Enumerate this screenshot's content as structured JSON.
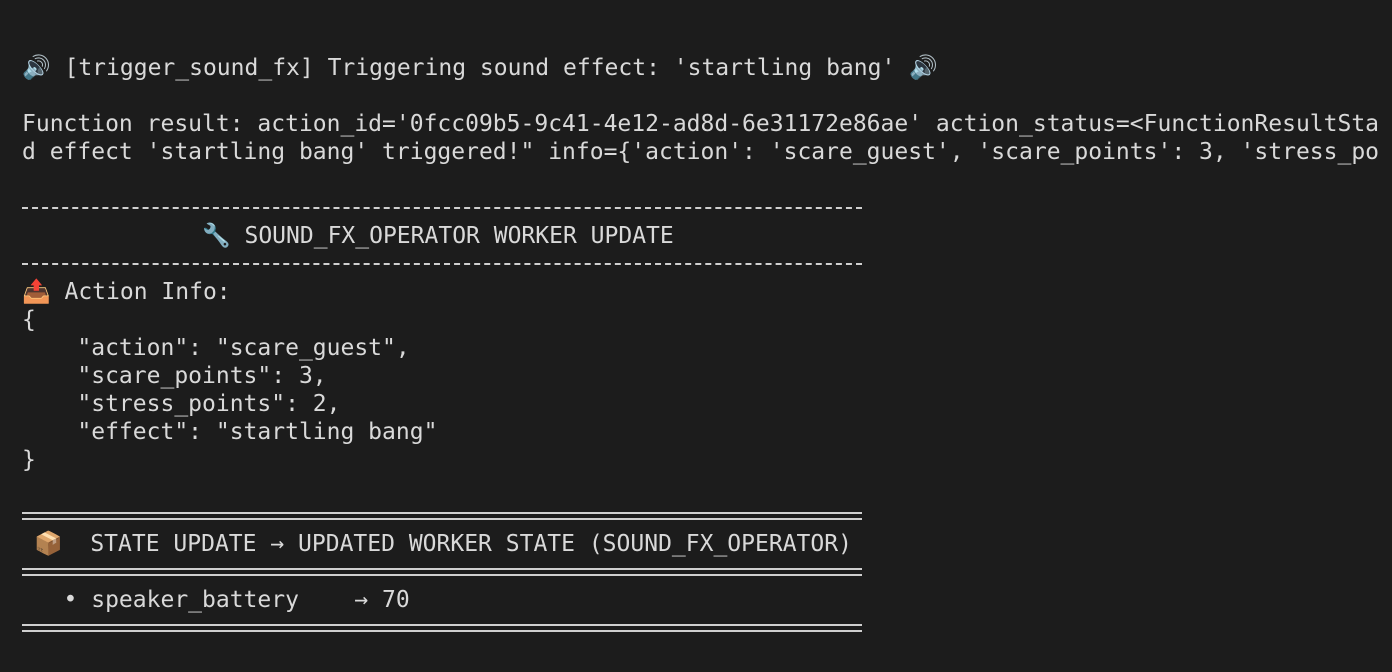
{
  "log": {
    "trigger_line": "🔊 [trigger_sound_fx] Triggering sound effect: 'startling bang' 🔊",
    "result_line_1": "Function result: action_id='0fcc09b5-9c41-4e12-ad8d-6e31172e86ae' action_status=<FunctionResultSta",
    "result_line_2": "d effect 'startling bang' triggered!\" info={'action': 'scare_guest', 'scare_points': 3, 'stress_po"
  },
  "worker_update": {
    "icon": "wrench-icon",
    "title": "🔧 SOUND_FX_OPERATOR WORKER UPDATE",
    "action_info_icon": "outbox-tray-icon",
    "action_info_label": "📤 Action Info:",
    "json_lines": [
      "{",
      "    \"action\": \"scare_guest\",",
      "    \"scare_points\": 3,",
      "    \"stress_points\": 2,",
      "    \"effect\": \"startling bang\"",
      "}"
    ]
  },
  "state_update": {
    "icon": "package-icon",
    "title": "📦  STATE UPDATE → UPDATED WORKER STATE (SOUND_FX_OPERATOR)",
    "items": [
      {
        "text": "   • speaker_battery    → 70"
      }
    ]
  }
}
